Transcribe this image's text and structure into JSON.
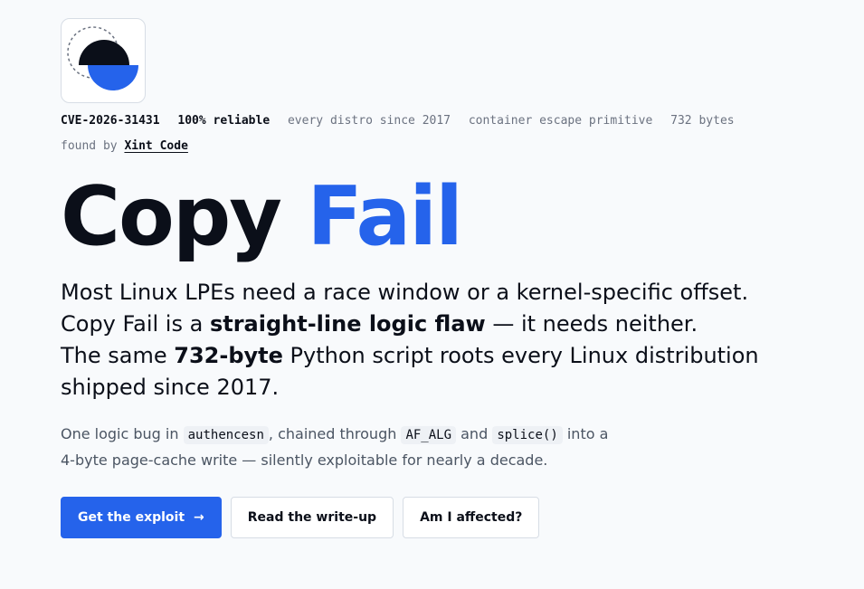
{
  "brand": {
    "logo_icon": "copy-fail-logo"
  },
  "meta": {
    "cve": "CVE-2026-31431",
    "reliability": "100% reliable",
    "tags": [
      "every distro since 2017",
      "container escape primitive",
      "732 bytes"
    ],
    "found_by_label": "found by",
    "found_by_link": "Xint Code"
  },
  "hero": {
    "title_part1": "Copy",
    "title_part2": "Fail",
    "accent_color": "#2563eb"
  },
  "lead": {
    "line1": "Most Linux LPEs need a race window or a kernel-specific offset.",
    "line2_pre": "Copy Fail is a",
    "line2_bold": "straight-line logic flaw",
    "line2_post": "— it needs neither.",
    "line3_pre": "The same",
    "line3_bold": "732-byte",
    "line3_post": "Python script roots every Linux distribution shipped since 2017."
  },
  "sub": {
    "t1": "One logic bug in",
    "code1": "authencesn",
    "t2": ", chained through",
    "code2": "AF_ALG",
    "t3": "and",
    "code3": "splice()",
    "t4": "into a",
    "line2": "4-byte page-cache write — silently exploitable for nearly a decade."
  },
  "actions": {
    "primary_label": "Get the exploit",
    "primary_icon": "arrow-right-icon",
    "writeup_label": "Read the write-up",
    "affected_label": "Am I affected?"
  }
}
